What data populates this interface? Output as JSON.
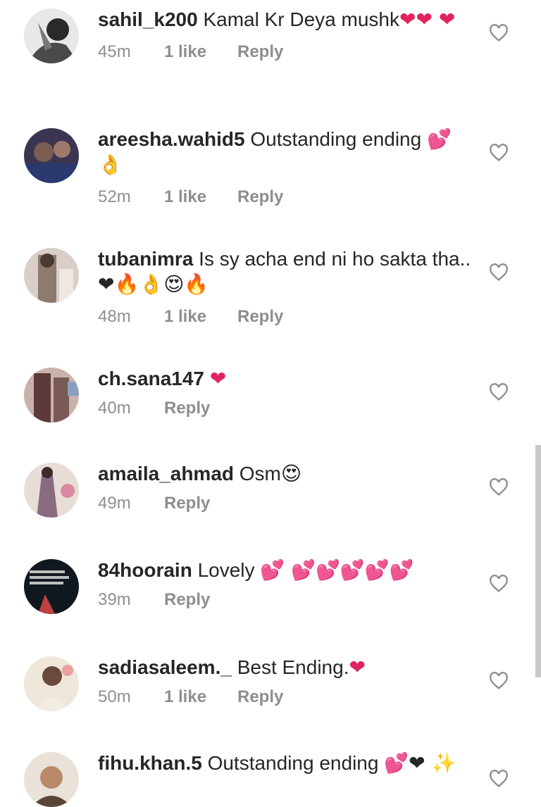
{
  "comments": [
    {
      "user": "sahil_k200",
      "text": "Kamal Kr Deya mushk",
      "emoji": "❤❤ ❤",
      "time": "45m",
      "likes": "1 like",
      "reply": "Reply"
    },
    {
      "user": "areesha.wahid5",
      "text": "Outstanding ending",
      "emoji": "💕 👌",
      "time": "52m",
      "likes": "1 like",
      "reply": "Reply"
    },
    {
      "user": "tubanimra",
      "text": "Is sy acha end ni ho sakta tha..",
      "emoji": "❤🔥👌😍🔥",
      "time": "48m",
      "likes": "1 like",
      "reply": "Reply"
    },
    {
      "user": "ch.sana147",
      "text": "",
      "emoji": "❤",
      "time": "40m",
      "likes": "",
      "reply": "Reply"
    },
    {
      "user": "amaila_ahmad",
      "text": "Osm",
      "emoji": "😍",
      "time": "49m",
      "likes": "",
      "reply": "Reply"
    },
    {
      "user": "84hoorain",
      "text": "Lovely",
      "emoji": "💕 💕💕💕💕💕",
      "time": "39m",
      "likes": "",
      "reply": "Reply"
    },
    {
      "user": "sadiasaleem._",
      "text": "Best Ending.",
      "emoji": "❤",
      "time": "50m",
      "likes": "1 like",
      "reply": "Reply"
    },
    {
      "user": "fihu.khan.5",
      "text": "Outstanding ending",
      "emoji": "💕❤ ✨",
      "time": "",
      "likes": "",
      "reply": ""
    }
  ],
  "icons": {
    "like": "heart-outline-icon"
  },
  "colors": {
    "text": "#262626",
    "meta": "#8e8e8e",
    "heart": "#e0245e"
  }
}
